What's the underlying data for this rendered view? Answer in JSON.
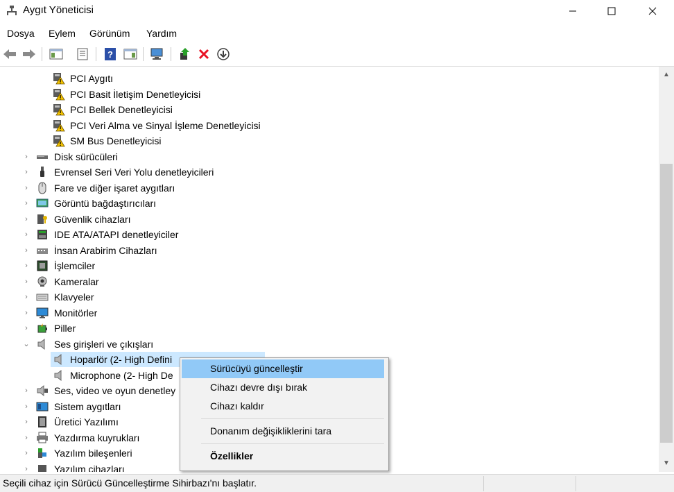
{
  "window": {
    "title": "Aygıt Yöneticisi"
  },
  "menu": [
    "Dosya",
    "Eylem",
    "Görünüm",
    "Yardım"
  ],
  "toolbar_icons": [
    "back-arrow-icon",
    "forward-arrow-icon",
    "show-hide-console-tree-icon",
    "properties-icon",
    "help-icon",
    "action-pane-icon",
    "scan-hardware-icon",
    "update-driver-icon",
    "uninstall-icon",
    "disable-icon"
  ],
  "tree": {
    "rows": [
      {
        "label": "PCI Aygıtı",
        "level": 2,
        "icon": "warning-device-icon",
        "expander": ""
      },
      {
        "label": "PCI Basit İletişim Denetleyicisi",
        "level": 2,
        "icon": "warning-device-icon",
        "expander": ""
      },
      {
        "label": "PCI Bellek Denetleyicisi",
        "level": 2,
        "icon": "warning-device-icon",
        "expander": ""
      },
      {
        "label": "PCI Veri Alma ve Sinyal İşleme Denetleyicisi",
        "level": 2,
        "icon": "warning-device-icon",
        "expander": ""
      },
      {
        "label": "SM Bus Denetleyicisi",
        "level": 2,
        "icon": "warning-device-icon",
        "expander": ""
      },
      {
        "label": "Disk sürücüleri",
        "level": 1,
        "icon": "disk-drive-icon",
        "expander": "›"
      },
      {
        "label": "Evrensel Seri Veri Yolu denetleyicileri",
        "level": 1,
        "icon": "usb-icon",
        "expander": "›"
      },
      {
        "label": "Fare ve diğer işaret aygıtları",
        "level": 1,
        "icon": "mouse-icon",
        "expander": "›"
      },
      {
        "label": "Görüntü bağdaştırıcıları",
        "level": 1,
        "icon": "display-adapter-icon",
        "expander": "›"
      },
      {
        "label": "Güvenlik cihazları",
        "level": 1,
        "icon": "security-device-icon",
        "expander": "›"
      },
      {
        "label": "IDE ATA/ATAPI denetleyiciler",
        "level": 1,
        "icon": "ide-controller-icon",
        "expander": "›"
      },
      {
        "label": "İnsan Arabirim Cihazları",
        "level": 1,
        "icon": "hid-icon",
        "expander": "›"
      },
      {
        "label": "İşlemciler",
        "level": 1,
        "icon": "processor-icon",
        "expander": "›"
      },
      {
        "label": "Kameralar",
        "level": 1,
        "icon": "camera-icon",
        "expander": "›"
      },
      {
        "label": "Klavyeler",
        "level": 1,
        "icon": "keyboard-icon",
        "expander": "›"
      },
      {
        "label": "Monitörler",
        "level": 1,
        "icon": "monitor-icon",
        "expander": "›"
      },
      {
        "label": "Piller",
        "level": 1,
        "icon": "battery-icon",
        "expander": "›"
      },
      {
        "label": "Ses girişleri ve çıkışları",
        "level": 1,
        "icon": "speaker-icon",
        "expander": "⌄"
      },
      {
        "label": "Hoparlör (2- High Defini",
        "level": 2,
        "icon": "speaker-icon",
        "expander": "",
        "selected": true
      },
      {
        "label": "Microphone (2- High De",
        "level": 2,
        "icon": "speaker-icon",
        "expander": ""
      },
      {
        "label": "Ses, video ve oyun denetley",
        "level": 1,
        "icon": "sound-video-icon",
        "expander": "›"
      },
      {
        "label": "Sistem aygıtları",
        "level": 1,
        "icon": "system-device-icon",
        "expander": "›"
      },
      {
        "label": "Üretici Yazılımı",
        "level": 1,
        "icon": "firmware-icon",
        "expander": "›"
      },
      {
        "label": "Yazdırma kuyrukları",
        "level": 1,
        "icon": "printer-icon",
        "expander": "›"
      },
      {
        "label": "Yazılım bileşenleri",
        "level": 1,
        "icon": "software-component-icon",
        "expander": "›"
      },
      {
        "label": "Yazılım cihazları",
        "level": 1,
        "icon": "software-device-icon",
        "expander": "›"
      }
    ]
  },
  "context_menu": {
    "items": [
      {
        "label": "Sürücüyü güncelleştir",
        "hover": true,
        "bold": false
      },
      {
        "label": "Cihazı devre dışı bırak",
        "hover": false,
        "bold": false
      },
      {
        "label": "Cihazı kaldır",
        "hover": false,
        "bold": false
      },
      {
        "separator": true
      },
      {
        "label": "Donanım değişikliklerini tara",
        "hover": false,
        "bold": false
      },
      {
        "separator": true
      },
      {
        "label": "Özellikler",
        "hover": false,
        "bold": true
      }
    ]
  },
  "status": {
    "text": "Seçili cihaz için Sürücü Güncelleştirme Sihirbazı'nı başlatır."
  },
  "colors": {
    "selection": "#cce8ff",
    "menu_hover": "#91c9f7",
    "warning": "#f5c400",
    "error_red": "#e81123"
  }
}
